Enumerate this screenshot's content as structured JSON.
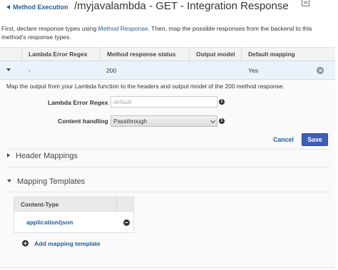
{
  "header": {
    "back_link": "Method Execution",
    "title": "/myjavalambda - GET - Integration Response"
  },
  "intro": {
    "before": "First, declare response types using ",
    "link": "Method Response",
    "after": ". Then, map the possible responses from the backend to this method's response types."
  },
  "table": {
    "columns": [
      "Lambda Error Regex",
      "Method response status",
      "Output model",
      "Default mapping"
    ],
    "rows": [
      {
        "regex": "-",
        "status": "200",
        "output_model": "",
        "default_mapping": "Yes"
      }
    ]
  },
  "details": {
    "description": "Map the output from your Lambda function to the headers and output model of the 200 method response.",
    "regex_label": "Lambda Error Regex",
    "regex_value": "",
    "regex_placeholder": "default",
    "content_handling_label": "Content handling",
    "content_handling_value": "Passthrough",
    "cancel_label": "Cancel",
    "save_label": "Save"
  },
  "sections": {
    "header_mappings": "Header Mappings",
    "mapping_templates": "Mapping Templates"
  },
  "mapping_templates": {
    "column_header": "Content-Type",
    "items": [
      "application/json"
    ],
    "add_label": "Add mapping template"
  },
  "colors": {
    "link": "#1f5c99",
    "primary_button": "#3d5eb9",
    "selected_row": "#eaf3fb"
  }
}
